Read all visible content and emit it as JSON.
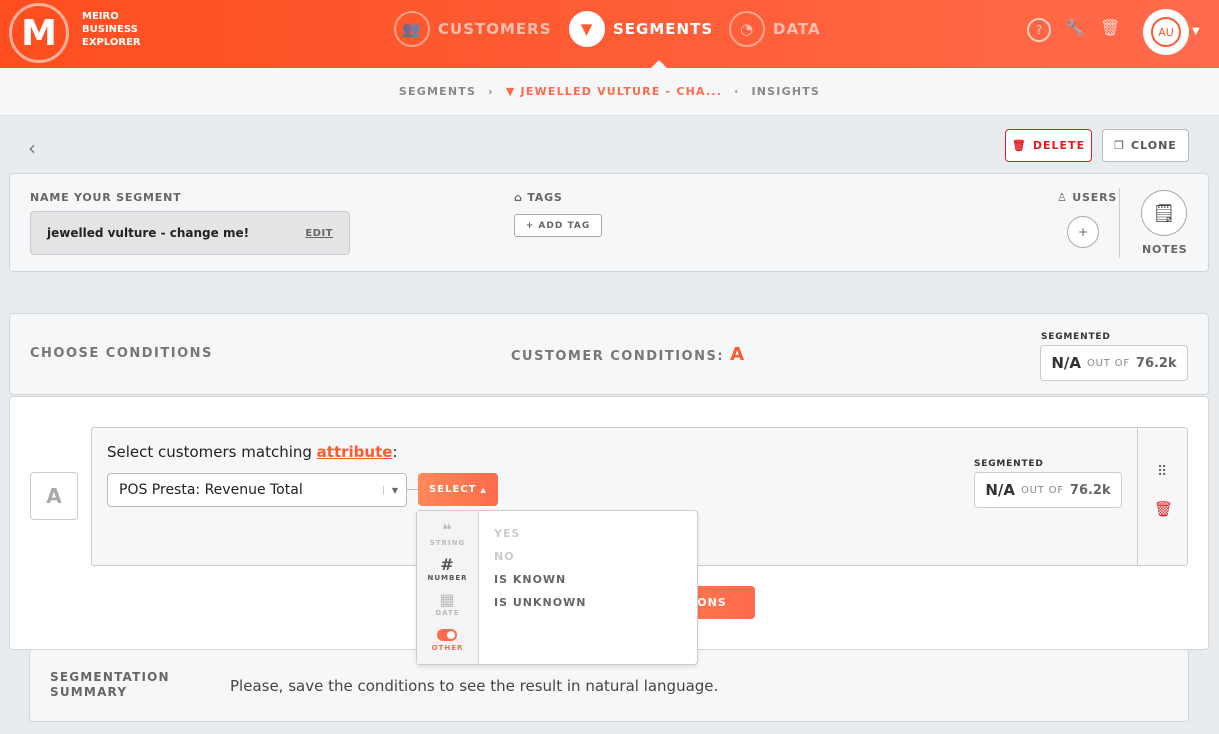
{
  "brand": {
    "line1": "MEIRO",
    "line2": "BUSINESS",
    "line3": "EXPLORER",
    "logo_letter": "M"
  },
  "nav": [
    {
      "label": "CUSTOMERS",
      "icon": "users-icon"
    },
    {
      "label": "SEGMENTS",
      "icon": "funnel-icon",
      "active": true
    },
    {
      "label": "DATA",
      "icon": "gauge-icon"
    }
  ],
  "header_icons": [
    "help-icon",
    "wrench-icon",
    "trash-icon"
  ],
  "user": {
    "initials": "AU"
  },
  "breadcrumb": {
    "root": "SEGMENTS",
    "current": "JEWELLED VULTURE - CHA...",
    "tail": "INSIGHTS"
  },
  "actions": {
    "delete": "DELETE",
    "clone": "CLONE"
  },
  "segment": {
    "name_label": "NAME YOUR SEGMENT",
    "name": "jewelled vulture - change me!",
    "edit": "EDIT",
    "tags_label": "TAGS",
    "add_tag": "+ ADD TAG",
    "users_label": "USERS",
    "notes_label": "NOTES"
  },
  "conditions": {
    "title": "CHOOSE CONDITIONS",
    "customer_conditions": "CUSTOMER CONDITIONS:",
    "letter": "A",
    "segmented_label": "SEGMENTED",
    "segmented_value": "N/A",
    "out_of": "OUT OF",
    "total": "76.2k"
  },
  "condition_row": {
    "letter": "A",
    "prompt": "Select customers matching ",
    "prompt_link": "attribute",
    "prompt_end": ":",
    "attribute": "POS Presta: Revenue Total",
    "select_label": "SELECT",
    "segmented_label": "SEGMENTED",
    "segmented_value": "N/A",
    "out_of": "OUT OF",
    "total": "76.2k",
    "save": "SAVE CONDITIONS"
  },
  "dropdown": {
    "types": [
      {
        "label": "STRING",
        "glyph": "❝"
      },
      {
        "label": "NUMBER",
        "glyph": "#"
      },
      {
        "label": "DATE",
        "glyph": "▦"
      },
      {
        "label": "OTHER",
        "glyph": "●"
      }
    ],
    "options": [
      {
        "label": "YES",
        "disabled": true
      },
      {
        "label": "NO",
        "disabled": true
      },
      {
        "label": "IS KNOWN"
      },
      {
        "label": "IS UNKNOWN"
      }
    ]
  },
  "summary": {
    "title1": "SEGMENTATION",
    "title2": "SUMMARY",
    "text": "Please, save the conditions to see the result in natural language."
  },
  "colors": {
    "accent": "#fe5a2d",
    "header_start": "#fe4e1f",
    "header_end": "#ff6b4b",
    "delete": "#e02020"
  }
}
